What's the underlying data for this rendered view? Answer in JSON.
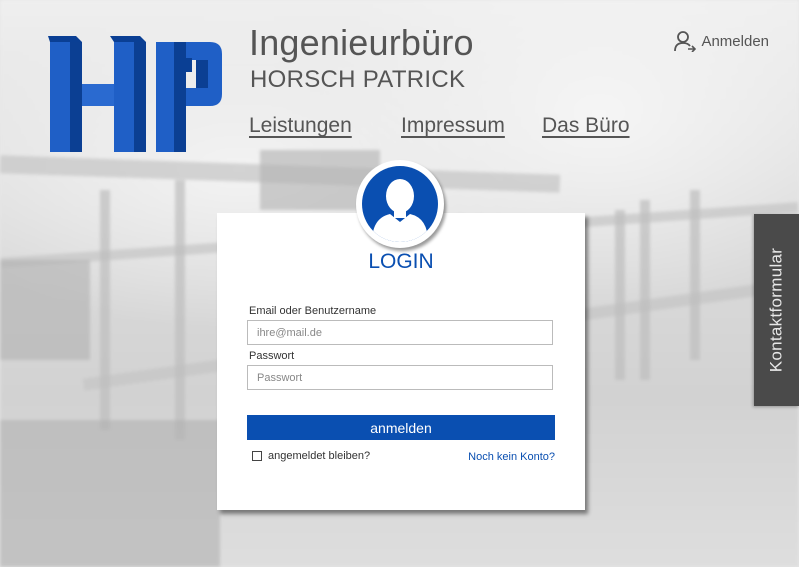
{
  "header": {
    "title": "Ingenieurbüro",
    "subtitle": "HORSCH PATRICK",
    "login_link": "Anmelden"
  },
  "nav": {
    "items": [
      "Leistungen",
      "Impressum",
      "Das Büro"
    ]
  },
  "side_tab": {
    "label": "Kontaktformular"
  },
  "login": {
    "title": "LOGIN",
    "user_label": "Email oder Benutzername",
    "user_placeholder": "ihre@mail.de",
    "password_label": "Passwort",
    "password_placeholder": "Passwort",
    "submit": "anmelden",
    "remember": "angemeldet bleiben?",
    "no_account": "Noch kein Konto?"
  },
  "colors": {
    "accent": "#0a4fb1",
    "logo_light": "#2b6fd0",
    "logo_dark": "#0a3f94"
  },
  "icons": [
    "user-outline-icon",
    "user-avatar-icon",
    "checkbox-icon"
  ]
}
